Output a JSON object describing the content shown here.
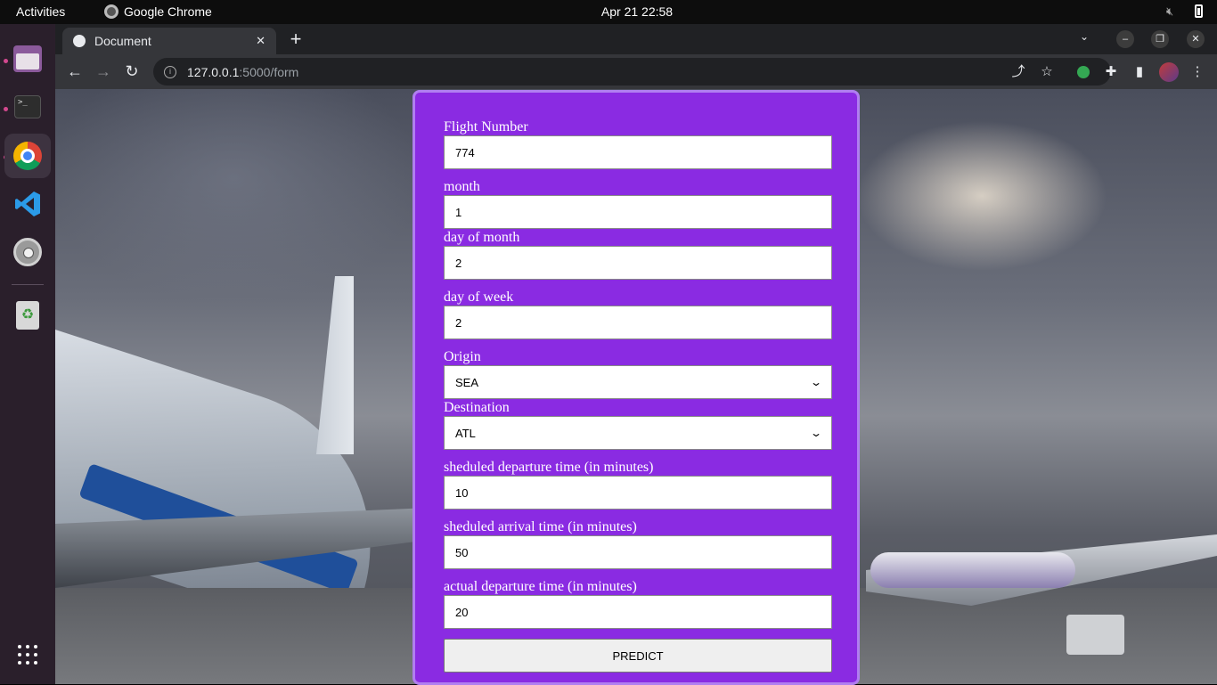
{
  "topbar": {
    "activities": "Activities",
    "app_name": "Google Chrome",
    "clock": "Apr 21  22:58"
  },
  "browser": {
    "tab_title": "Document",
    "url_host": "127.0.0.1",
    "url_path": ":5000/form"
  },
  "form": {
    "fields": [
      {
        "label": "Flight Number",
        "value": "774"
      },
      {
        "label": "month",
        "value": "1"
      },
      {
        "label": "day of month",
        "value": "2"
      },
      {
        "label": "day of week",
        "value": "2"
      },
      {
        "label": "Origin",
        "value": "SEA",
        "type": "select"
      },
      {
        "label": "Destination",
        "value": "ATL",
        "type": "select"
      },
      {
        "label": "sheduled departure time (in minutes)",
        "value": "10"
      },
      {
        "label": "sheduled arrival time (in minutes)",
        "value": "50"
      },
      {
        "label": "actual departure time (in minutes)",
        "value": "20"
      }
    ],
    "submit_label": "PREDICT",
    "accent_color": "#8a2be2"
  },
  "icons": {
    "dock": [
      "files-icon",
      "terminal-icon",
      "chrome-icon",
      "vscode-icon",
      "settings-icon",
      "trash-icon",
      "app-grid-icon"
    ]
  }
}
